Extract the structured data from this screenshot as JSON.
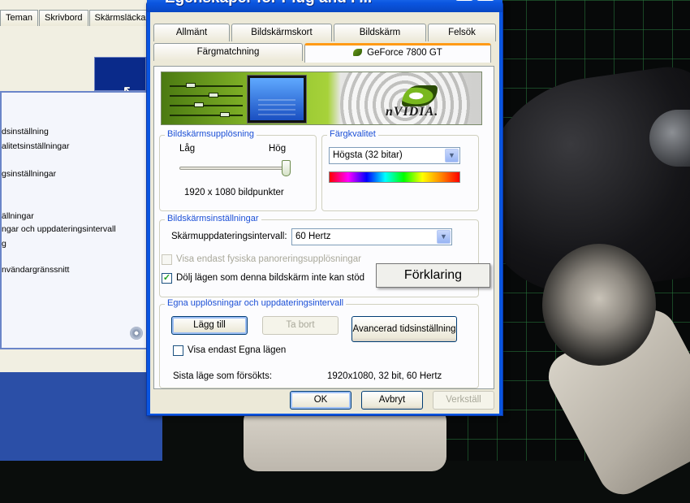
{
  "dialog": {
    "title": "Egenskaper för Plug and P...",
    "tabs_row1": [
      "Allmänt",
      "Bildskärmskort",
      "Bildskärm",
      "Felsök"
    ],
    "tabs_row2": [
      "Färgmatchning",
      "GeForce 7800 GT"
    ],
    "active_tab": "GeForce 7800 GT",
    "banner_logo_text": "nVIDIA."
  },
  "resolution": {
    "legend": "Bildskärmsupplösning",
    "low_label": "Låg",
    "high_label": "Hög",
    "value_text": "1920 x 1080 bildpunkter",
    "slider_level": 1.0
  },
  "color_quality": {
    "legend": "Färgkvalitet",
    "selected": "Högsta (32 bitar)"
  },
  "display_settings": {
    "legend": "Bildskärmsinställningar",
    "refresh_label": "Skärmuppdateringsintervall:",
    "refresh_selected": "60 Hertz",
    "checkbox_physical": {
      "label": "Visa endast fysiska panoreringsupplösningar",
      "checked": false,
      "enabled": false
    },
    "checkbox_hide": {
      "label": "Dölj lägen som denna bildskärm inte kan stöd",
      "checked": true,
      "enabled": true
    }
  },
  "tooltip": {
    "text": "Förklaring"
  },
  "custom_modes": {
    "legend": "Egna upplösningar och uppdateringsintervall",
    "add_button": "Lägg till",
    "remove_button": "Ta bort",
    "advanced_button": "Avancerad tidsinställning",
    "checkbox_own": {
      "label": "Visa endast Egna lägen",
      "checked": false
    },
    "last_mode_label": "Sista läge som försökts:",
    "last_mode_value": "1920x1080, 32 bit, 60 Hertz"
  },
  "footer": {
    "ok": "OK",
    "cancel": "Avbryt",
    "apply": "Verkställ"
  },
  "background_window": {
    "tabs": [
      "Teman",
      "Skrivbord",
      "Skärmsläckar"
    ],
    "list_items": [
      "dsinställning",
      "alitetsinställningar",
      "gsinställningar",
      "ällningar",
      "ngar och uppdateringsintervall",
      "g",
      "nvändargränssnitt"
    ]
  }
}
